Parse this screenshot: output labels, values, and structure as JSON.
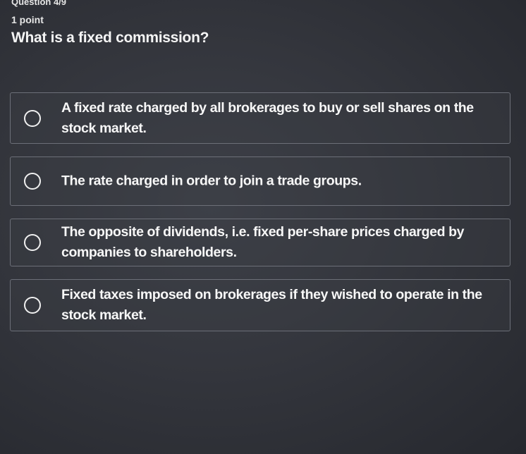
{
  "header": {
    "question_number": "Question 4/9",
    "points": "1 point",
    "question_text": "What is a fixed commission?"
  },
  "options": [
    {
      "label": "A fixed rate charged by all brokerages to buy or sell shares on the stock market."
    },
    {
      "label": "The rate charged in order to join a trade groups."
    },
    {
      "label": "The opposite of dividends, i.e. fixed per-share prices charged by companies to shareholders."
    },
    {
      "label": "Fixed taxes imposed on brokerages if they wished to operate in the stock market."
    }
  ]
}
